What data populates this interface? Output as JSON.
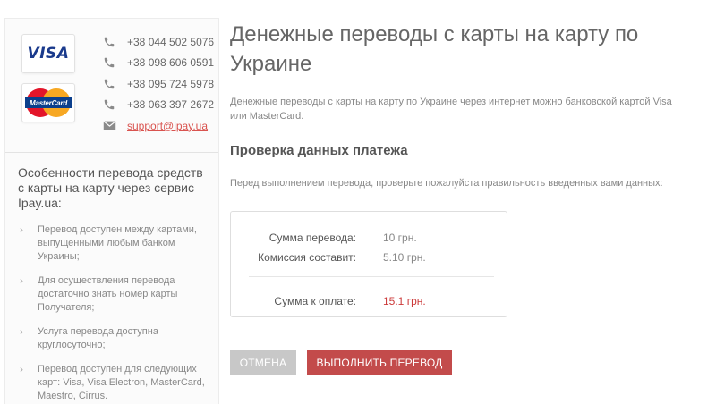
{
  "sidebar": {
    "cards": {
      "visa": "VISA",
      "mastercard": "MasterCard"
    },
    "contacts": [
      {
        "type": "phone",
        "icon": "phone-icon",
        "text": "+38 044 502 5076"
      },
      {
        "type": "phone",
        "icon": "phone-icon",
        "text": "+38 098 606 0591"
      },
      {
        "type": "phone",
        "icon": "phone-icon",
        "text": "+38 095 724 5978"
      },
      {
        "type": "phone",
        "icon": "phone-icon",
        "text": "+38 063 397 2672"
      },
      {
        "type": "email",
        "icon": "envelope-icon",
        "text": "support@ipay.ua"
      }
    ],
    "features_title": "Особенности перевода средств с карты на карту через сервис Ipay.ua:",
    "features": [
      "Перевод доступен между картами, выпущенными любым банком Украины;",
      "Для осуществления перевода достаточно знать номер карты Получателя;",
      "Услуга перевода доступна круглосуточно;",
      "Перевод доступен для следующих карт: Visa, Visa Electron, MasterCard, Maestro, Cirrus."
    ]
  },
  "main": {
    "title": "Денежные переводы с карты на карту по Украине",
    "lead": "Денежные переводы с карты на карту по Украине через интернет можно банковской картой Visa или MasterCard.",
    "section_title": "Проверка данных платежа",
    "notice": "Перед выполнением перевода, проверьте пожалуйста правильность введенных вами данных:",
    "summary": {
      "amount_label": "Сумма перевода:",
      "amount_value": "10 грн.",
      "fee_label": "Комиссия составит:",
      "fee_value": "5.10 грн.",
      "total_label": "Сумма к оплате:",
      "total_value": "15.1 грн."
    },
    "buttons": {
      "cancel": "ОТМЕНА",
      "submit": "ВЫПОЛНИТЬ ПЕРЕВОД"
    }
  },
  "colors": {
    "accent": "#c34b4b",
    "total": "#cc3b3b",
    "link": "#d9534f",
    "cancel": "#c8c8c8"
  }
}
